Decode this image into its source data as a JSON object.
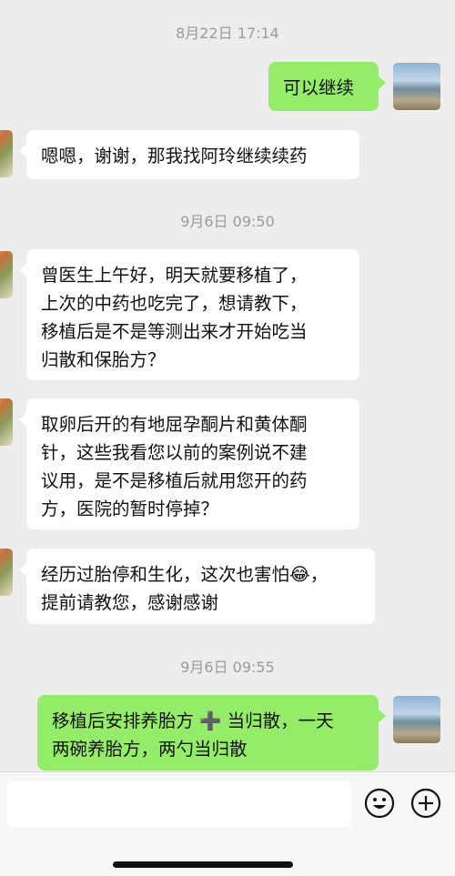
{
  "messages": {
    "t1": "8月22日 17:14",
    "m1": "可以继续",
    "m2": "嗯嗯，谢谢，那我找阿玲继续续药",
    "t2": "9月6日 09:50",
    "m3": "曾医生上午好，明天就要移植了，\n上次的中药也吃完了，想请教下，\n移植后是不是等测出来才开始吃当\n归散和保胎方？",
    "m4": "取卵后开的有地屈孕酮片和黄体酮\n针，这些我看您以前的案例说不建\n议用，是不是移植后就用您开的药\n方，医院的暂时停掉？",
    "m5": "经历过胎停和生化，这次也害怕😂，\n提前请教您，感谢感谢",
    "t3": "9月6日 09:55",
    "m6": "移植后安排养胎方 ➕ 当归散，一天\n两碗养胎方，两勺当归散"
  },
  "input": {
    "value": ""
  },
  "icons": {
    "emoji": "emoji-icon",
    "plus": "plus-icon"
  }
}
